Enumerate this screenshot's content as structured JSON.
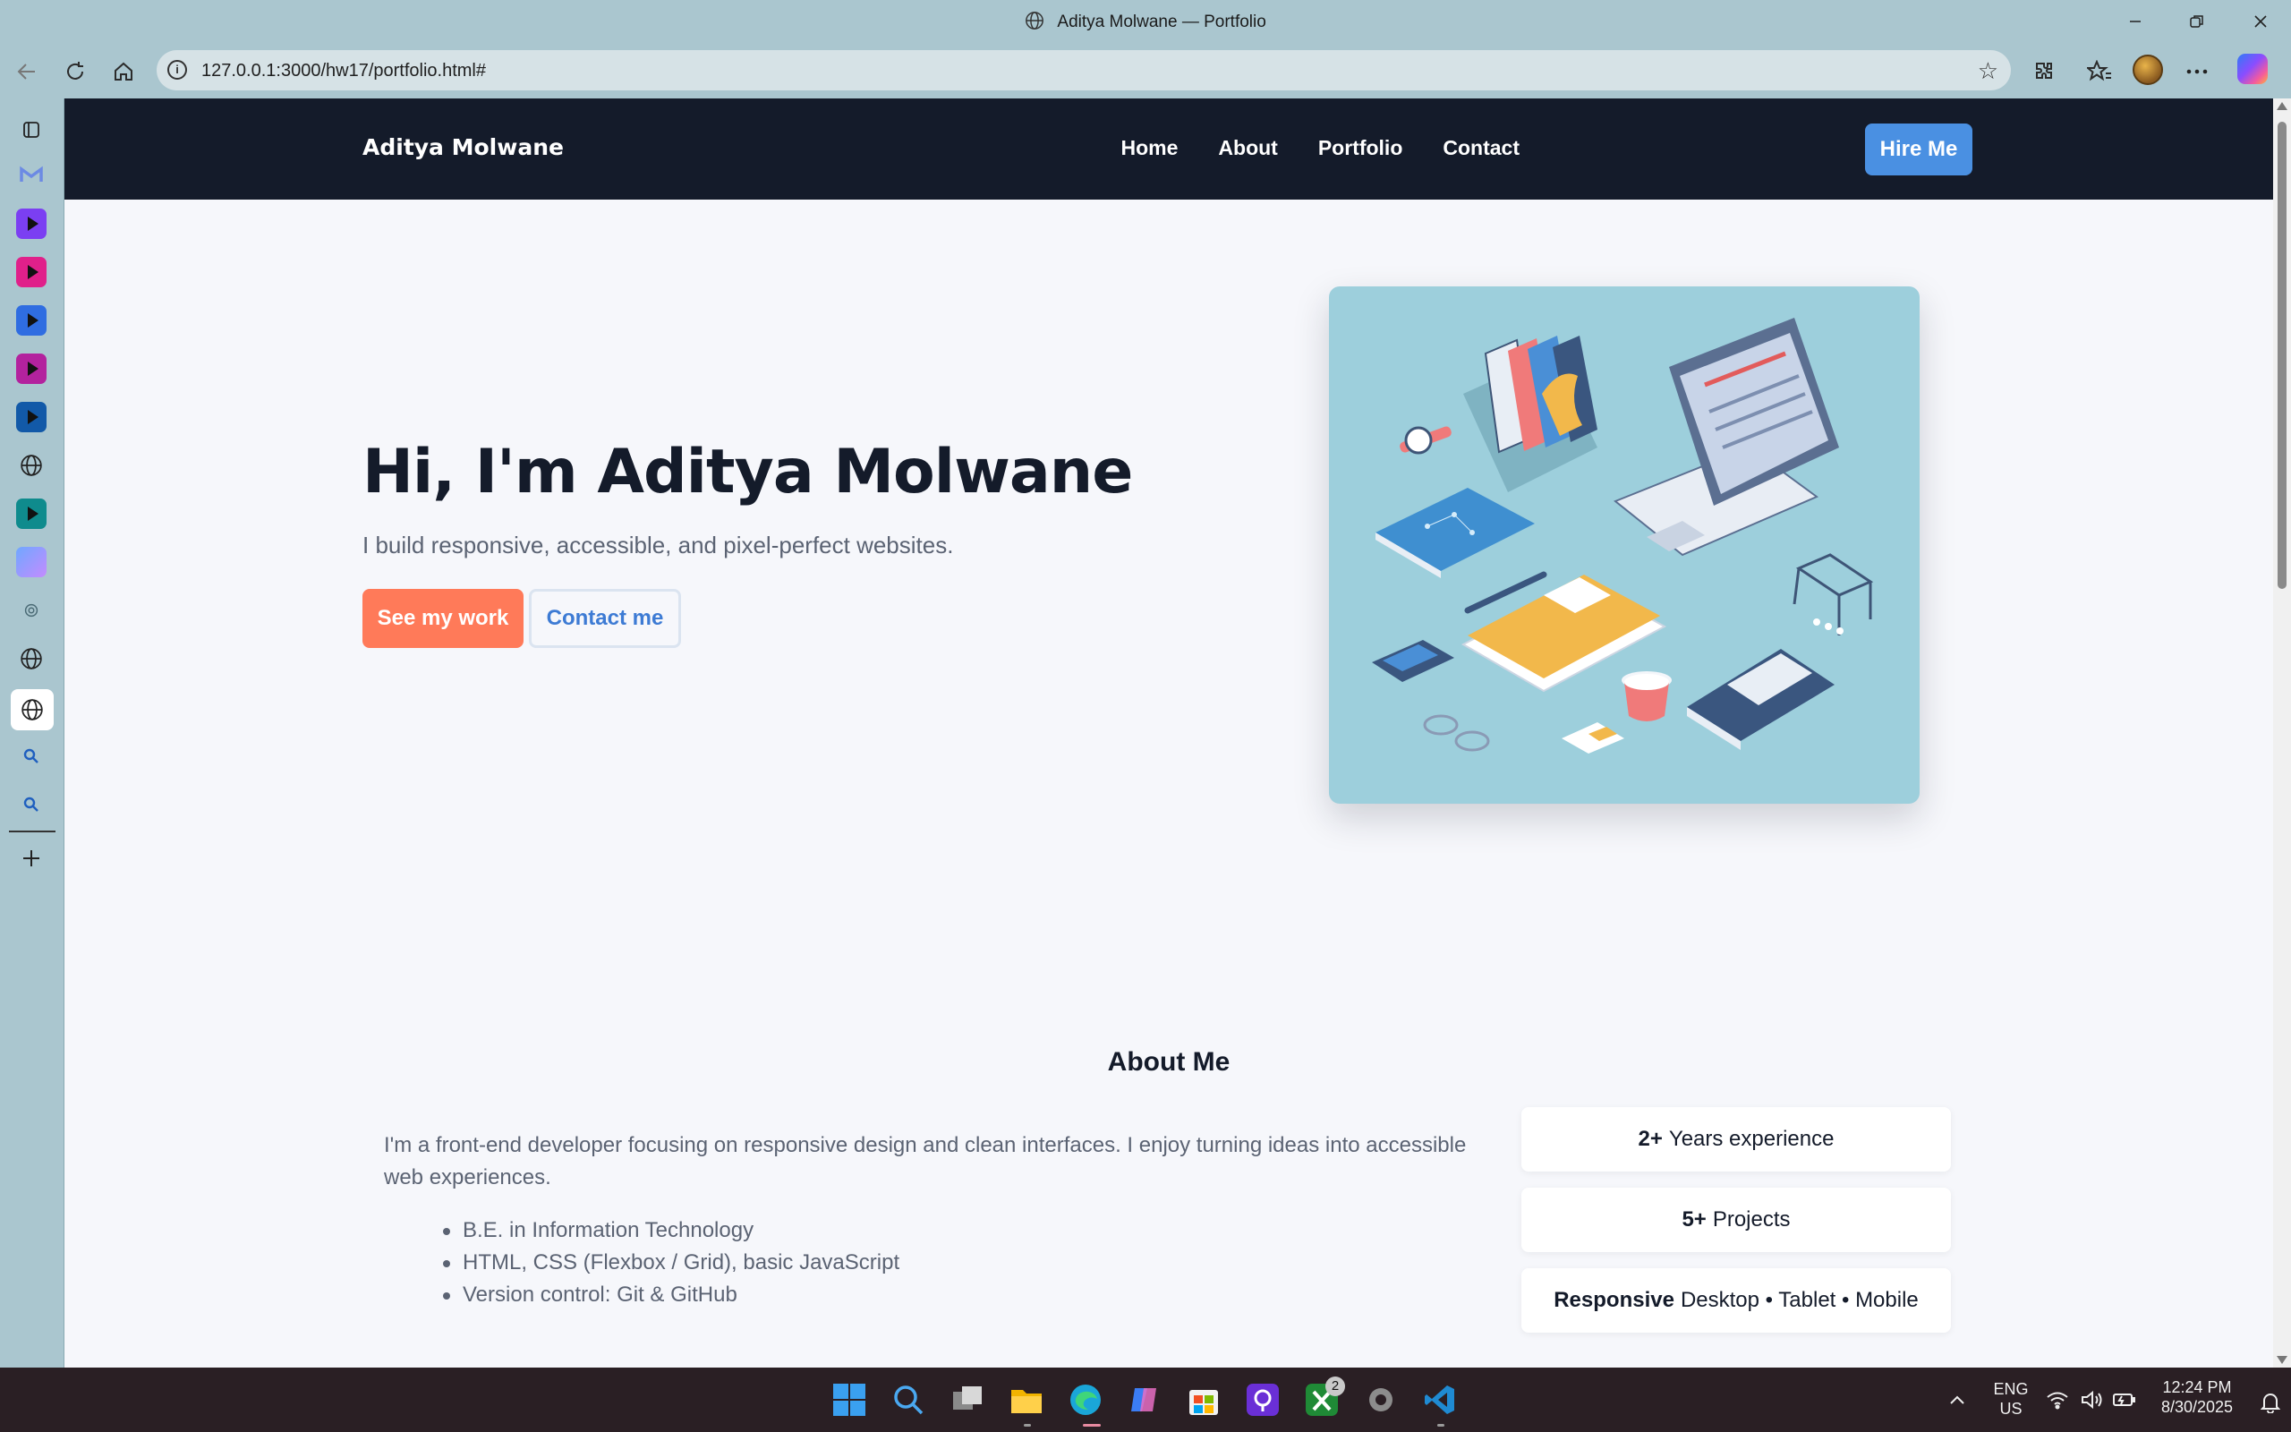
{
  "browser": {
    "window_title": "Aditya Molwane — Portfolio",
    "url": "127.0.0.1:3000/hw17/portfolio.html#"
  },
  "nav": {
    "brand": "Aditya Molwane",
    "links": [
      "Home",
      "About",
      "Portfolio",
      "Contact"
    ],
    "cta": "Hire Me"
  },
  "hero": {
    "title": "Hi, I'm Aditya Molwane",
    "subtitle": "I build responsive, accessible, and pixel-perfect websites.",
    "primary_button": "See my work",
    "secondary_button": "Contact me",
    "illustration": "workspace-illustration"
  },
  "about": {
    "heading": "About Me",
    "intro": "I'm a front-end developer focusing on responsive design and clean interfaces. I enjoy turning ideas into accessible web experiences.",
    "bullets": [
      "B.E. in Information Technology",
      "HTML, CSS (Flexbox / Grid), basic JavaScript",
      "Version control: Git & GitHub"
    ],
    "stats": [
      {
        "bold": "2+",
        "text": "Years experience"
      },
      {
        "bold": "5+",
        "text": "Projects"
      },
      {
        "bold": "Responsive",
        "text": "Desktop • Tablet • Mobile"
      }
    ]
  },
  "taskbar": {
    "lang_line1": "ENG",
    "lang_line2": "US",
    "time": "12:24 PM",
    "date": "8/30/2025",
    "xbox_badge": "2"
  },
  "colors": {
    "nav_bg": "#141b2a",
    "accent_blue": "#4a90e2",
    "accent_orange": "#ff7a59",
    "page_bg": "#f6f7fb",
    "chrome_bg": "#aac6cf"
  }
}
